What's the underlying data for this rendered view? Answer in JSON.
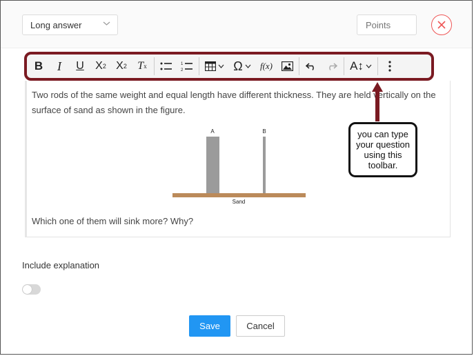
{
  "header": {
    "question_type": "Long answer",
    "points_placeholder": "Points"
  },
  "toolbar": {
    "items": [
      {
        "name": "bold-icon",
        "glyph": "B"
      },
      {
        "name": "italic-icon",
        "glyph": "I"
      },
      {
        "name": "underline-icon",
        "glyph": "U"
      },
      {
        "name": "superscript-icon",
        "glyph": "X²"
      },
      {
        "name": "subscript-icon",
        "glyph": "X₂"
      },
      {
        "name": "clear-format-icon",
        "glyph": "Tx"
      },
      {
        "name": "bullet-list-icon"
      },
      {
        "name": "numbered-list-icon"
      },
      {
        "name": "table-icon"
      },
      {
        "name": "special-char-icon",
        "glyph": "Ω"
      },
      {
        "name": "formula-icon",
        "glyph": "f(x)"
      },
      {
        "name": "image-icon"
      },
      {
        "name": "undo-icon"
      },
      {
        "name": "redo-icon"
      },
      {
        "name": "font-size-icon",
        "glyph": "AI"
      },
      {
        "name": "more-icon"
      }
    ]
  },
  "question": {
    "text": "Two rods of the same weight and equal length have different thickness. They are held vertically on the surface of sand as shown in the figure.",
    "figure": {
      "label_a": "A",
      "label_b": "B",
      "label_sand": "Sand"
    },
    "prompt": "Which one of them will sink more? Why?"
  },
  "callout": {
    "text": "you can type your question using this toolbar."
  },
  "explanation": {
    "label": "Include explanation",
    "enabled": false
  },
  "actions": {
    "save": "Save",
    "cancel": "Cancel"
  },
  "colors": {
    "accent": "#2196f3",
    "close": "#e55555",
    "callout_border": "#7a1a22"
  }
}
